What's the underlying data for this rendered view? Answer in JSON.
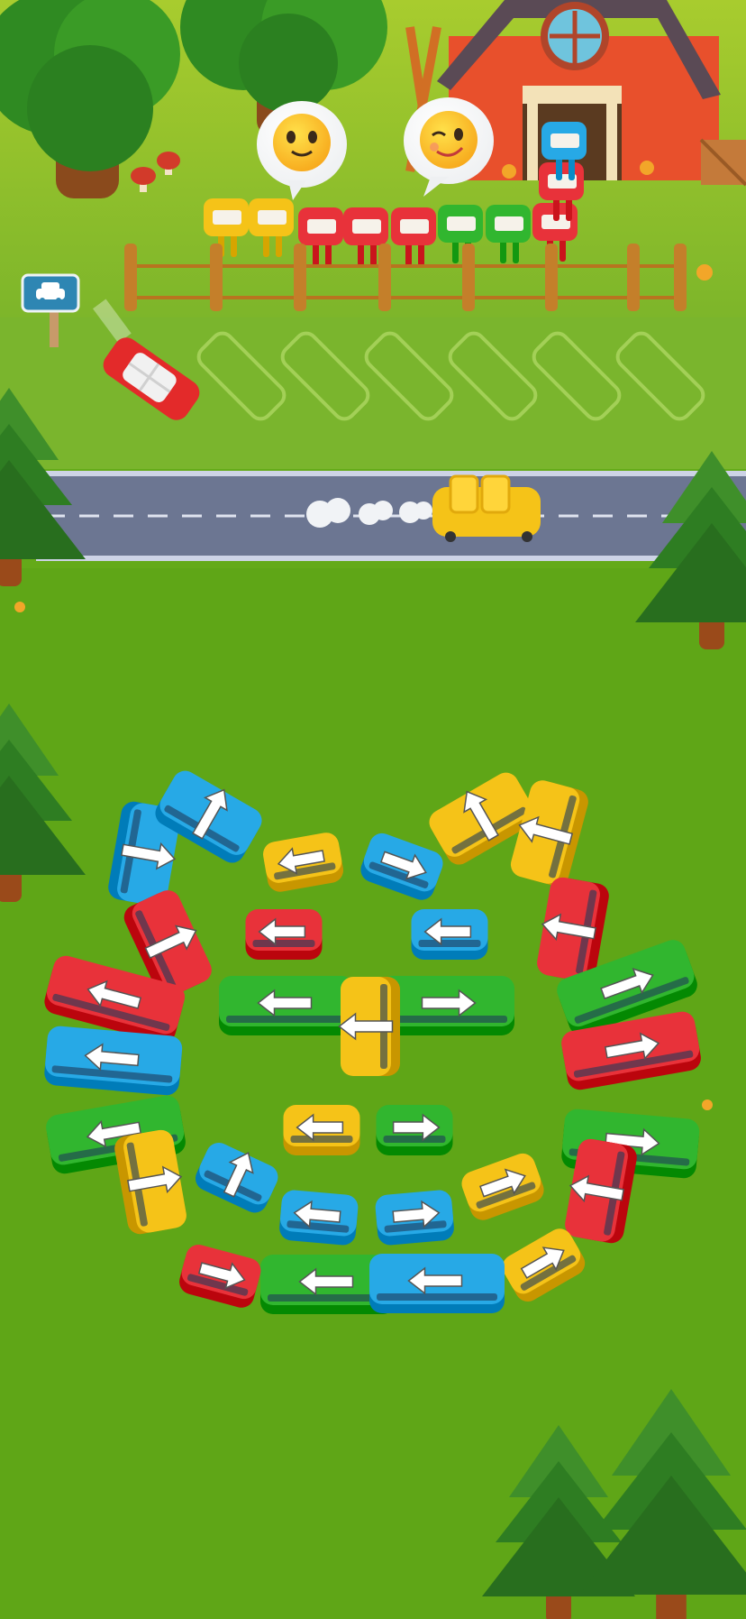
{
  "game": {
    "title": "",
    "emoji_bubbles": [
      {
        "name": "happy-face-bubble-icon",
        "face": "happy"
      },
      {
        "name": "wink-face-bubble-icon",
        "face": "wink"
      }
    ],
    "queue_passengers": [
      "yellow",
      "yellow",
      "red",
      "red",
      "red",
      "green",
      "green",
      "red",
      "red",
      "blue"
    ],
    "parking_slots_empty": 6,
    "parking_sign_icon": "car-icon",
    "moving_cars": [
      {
        "name": "red-car-leaving",
        "color": "red"
      },
      {
        "name": "yellow-car-on-road",
        "color": "yellow"
      }
    ],
    "grid_vehicles": [
      {
        "type": "van",
        "color": "blue",
        "dir": "up"
      },
      {
        "type": "van",
        "color": "blue",
        "dir": "up"
      },
      {
        "type": "car",
        "color": "yellow",
        "dir": "left"
      },
      {
        "type": "car",
        "color": "blue",
        "dir": "right"
      },
      {
        "type": "van",
        "color": "yellow",
        "dir": "up"
      },
      {
        "type": "van",
        "color": "yellow",
        "dir": "up"
      },
      {
        "type": "van",
        "color": "red",
        "dir": "up"
      },
      {
        "type": "car",
        "color": "red",
        "dir": "left"
      },
      {
        "type": "car",
        "color": "blue",
        "dir": "left"
      },
      {
        "type": "van",
        "color": "red",
        "dir": "up"
      },
      {
        "type": "bus",
        "color": "red",
        "dir": "left"
      },
      {
        "type": "bus",
        "color": "green",
        "dir": "left"
      },
      {
        "type": "bus",
        "color": "green",
        "dir": "right"
      },
      {
        "type": "bus",
        "color": "green",
        "dir": "right"
      },
      {
        "type": "bus",
        "color": "blue",
        "dir": "left"
      },
      {
        "type": "van",
        "color": "yellow",
        "dir": "up"
      },
      {
        "type": "bus",
        "color": "red",
        "dir": "right"
      },
      {
        "type": "bus",
        "color": "green",
        "dir": "left"
      },
      {
        "type": "car",
        "color": "yellow",
        "dir": "left"
      },
      {
        "type": "car",
        "color": "green",
        "dir": "right"
      },
      {
        "type": "bus",
        "color": "green",
        "dir": "right"
      },
      {
        "type": "van",
        "color": "yellow",
        "dir": "up"
      },
      {
        "type": "car",
        "color": "blue",
        "dir": "up"
      },
      {
        "type": "car",
        "color": "blue",
        "dir": "left"
      },
      {
        "type": "car",
        "color": "blue",
        "dir": "right"
      },
      {
        "type": "car",
        "color": "yellow",
        "dir": "right"
      },
      {
        "type": "van",
        "color": "red",
        "dir": "up"
      },
      {
        "type": "car",
        "color": "yellow",
        "dir": "right"
      },
      {
        "type": "bus",
        "color": "green",
        "dir": "left"
      },
      {
        "type": "bus",
        "color": "blue",
        "dir": "left"
      },
      {
        "type": "car",
        "color": "red",
        "dir": "right"
      }
    ],
    "colors": {
      "grass": "#5fa617",
      "grass_dark": "#56991a",
      "upper_grass": "#8fc02a",
      "road": "#6f7a96",
      "barn": "#e8502c",
      "red": "#e8323a",
      "blue": "#27a9e6",
      "green": "#31b62f",
      "yellow": "#f5c318"
    }
  }
}
